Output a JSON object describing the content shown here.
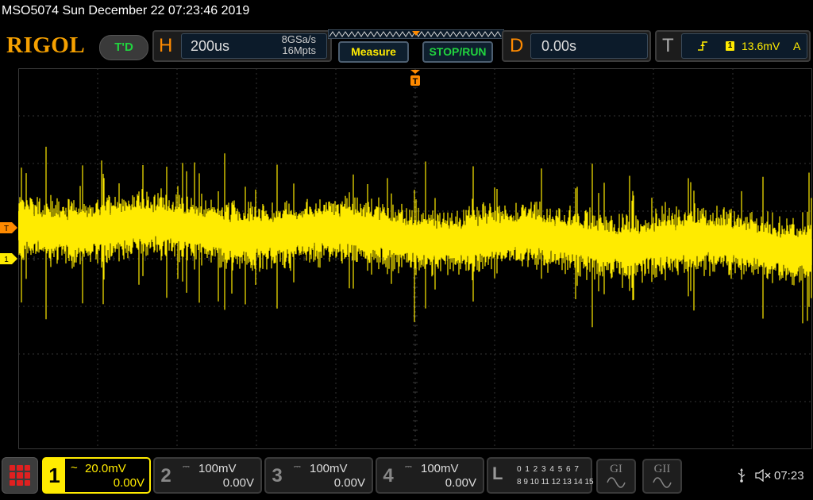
{
  "title": "MSO5074  Sun December 22 07:23:46 2019",
  "toolbar": {
    "logo": "RIGOL",
    "run_state": "T'D",
    "horizontal": {
      "letter": "H",
      "timebase": "200us",
      "sample_rate": "8GSa/s",
      "memory_depth": "16Mpts"
    },
    "measure_label": "Measure",
    "stoprun_label": "STOP/RUN",
    "delay": {
      "letter": "D",
      "value": "0.00s"
    },
    "trigger": {
      "letter": "T",
      "source": "1",
      "level": "13.6mV",
      "mode": "A"
    }
  },
  "markers": {
    "trigger_level": "T",
    "channel1": "1"
  },
  "channels": [
    {
      "num": "1",
      "scale": "20.0mV",
      "offset": "0.00V",
      "coupling_icon": "~"
    },
    {
      "num": "2",
      "scale": "100mV",
      "offset": "0.00V",
      "coupling_icon": "⎓"
    },
    {
      "num": "3",
      "scale": "100mV",
      "offset": "0.00V",
      "coupling_icon": "⎓"
    },
    {
      "num": "4",
      "scale": "100mV",
      "offset": "0.00V",
      "coupling_icon": "⎓"
    }
  ],
  "logic": {
    "letter": "L",
    "row1": "0 1 2 3  4 5 6 7",
    "row2": "8 9 10 11 12 13 14 15"
  },
  "generators": [
    {
      "label": "GI"
    },
    {
      "label": "GII"
    }
  ],
  "status": {
    "time": "07:23"
  },
  "colors": {
    "ch1": "#ffeb00",
    "accent": "#ff8a00",
    "grid": "#3a3a3a",
    "ok_green": "#21d43f"
  },
  "icons": [
    "menu-icon",
    "trigger-edge-icon",
    "usb-icon",
    "speaker-muted-icon",
    "sine-wave-icon"
  ]
}
